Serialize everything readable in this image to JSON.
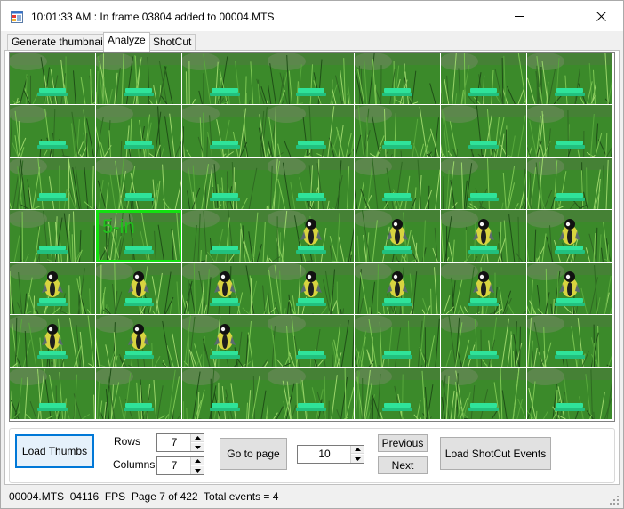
{
  "window": {
    "title": "10:01:33 AM : In frame 03804 added to 00004.MTS",
    "icon": "app-window-icon",
    "controls": [
      "minimize-icon",
      "maximize-icon",
      "close-icon"
    ]
  },
  "tabs": [
    {
      "label": "Generate thumbnails",
      "active": false
    },
    {
      "label": "Analyze",
      "active": true
    },
    {
      "label": "ShotCut",
      "active": false
    }
  ],
  "thumbnails": {
    "rows": 7,
    "columns": 7,
    "selected": {
      "row": 3,
      "col": 1,
      "label": "5-in",
      "color": "#13e010"
    },
    "bird_cells": [
      [
        3,
        3
      ],
      [
        3,
        4
      ],
      [
        3,
        5
      ],
      [
        3,
        6
      ],
      [
        4,
        0
      ],
      [
        4,
        1
      ],
      [
        4,
        2
      ],
      [
        4,
        3
      ],
      [
        4,
        4
      ],
      [
        4,
        5
      ],
      [
        4,
        6
      ],
      [
        5,
        0
      ],
      [
        5,
        1
      ],
      [
        5,
        2
      ]
    ],
    "colors": {
      "grass": "#3b8a2a",
      "feeder": "#2fe39a"
    }
  },
  "controls": {
    "load_thumbs": "Load Thumbs",
    "rows_label": "Rows",
    "rows_value": "7",
    "columns_label": "Columns",
    "columns_value": "7",
    "go_to_page": "Go to page",
    "page_value": "10",
    "previous": "Previous",
    "next": "Next",
    "load_shotcut": "Load ShotCut Events"
  },
  "status": {
    "text": "00004.MTS  04116  FPS  Page 7 of 422  Total events = 4"
  }
}
